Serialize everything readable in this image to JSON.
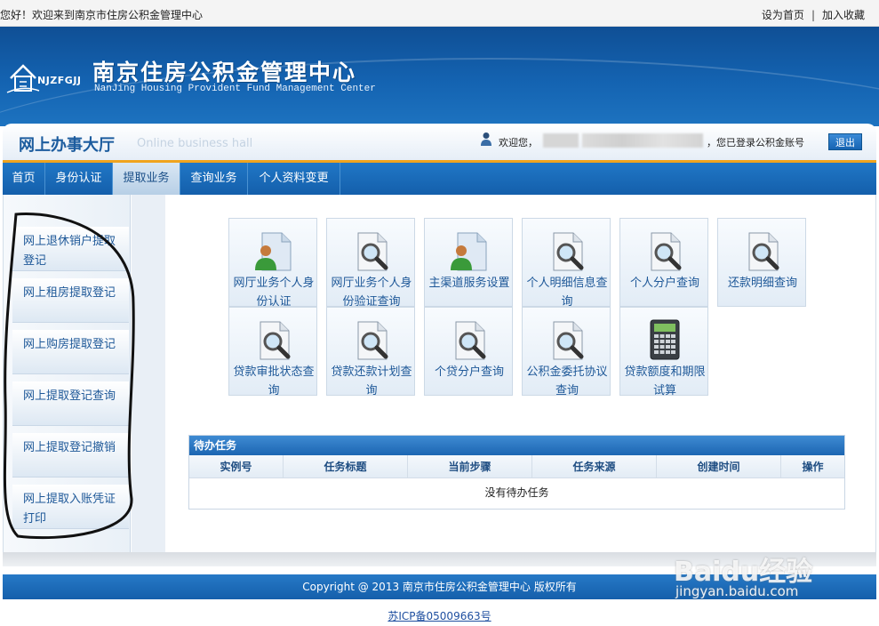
{
  "topbar": {
    "greeting": "您好！欢迎来到南京市住房公积金管理中心",
    "set_home": "设为首页",
    "separator": "|",
    "add_favorite": "加入收藏"
  },
  "banner": {
    "logo_text": "NJZFGJJ",
    "title_cn": "南京住房公积金管理中心",
    "title_en": "NanJing Housing Provident Fund Management Center"
  },
  "hall": {
    "title_cn": "网上办事大厅",
    "title_en": "Online business hall",
    "welcome": "欢迎您，",
    "logged_in": "，您已登录公积金账号",
    "logout": "退出"
  },
  "nav": {
    "tabs": [
      {
        "label": "首页"
      },
      {
        "label": "身份认证"
      },
      {
        "label": "提取业务"
      },
      {
        "label": "查询业务"
      },
      {
        "label": "个人资料变更"
      }
    ],
    "active_index": 2
  },
  "sidebar": {
    "items": [
      {
        "label": "网上退休销户提取登记"
      },
      {
        "label": "网上租房提取登记"
      },
      {
        "label": "网上购房提取登记"
      },
      {
        "label": "网上提取登记查询"
      },
      {
        "label": "网上提取登记撤销"
      },
      {
        "label": "网上提取入账凭证打印"
      }
    ]
  },
  "services": [
    {
      "label": "网厅业务个人身份认证",
      "icon": "user-doc-icon"
    },
    {
      "label": "网厅业务个人身份验证查询",
      "icon": "search-doc-icon"
    },
    {
      "label": "主渠道服务设置",
      "icon": "user-doc-icon"
    },
    {
      "label": "个人明细信息查询",
      "icon": "search-doc-icon"
    },
    {
      "label": "个人分户查询",
      "icon": "search-doc-icon"
    },
    {
      "label": "还款明细查询",
      "icon": "search-doc-icon"
    },
    {
      "label": "贷款审批状态查询",
      "icon": "search-doc-icon"
    },
    {
      "label": "贷款还款计划查询",
      "icon": "search-doc-icon"
    },
    {
      "label": "个贷分户查询",
      "icon": "search-doc-icon"
    },
    {
      "label": "公积金委托协议查询",
      "icon": "search-doc-icon"
    },
    {
      "label": "贷款额度和期限试算",
      "icon": "calculator-icon"
    }
  ],
  "tasks": {
    "title": "待办任务",
    "columns": [
      "实例号",
      "任务标题",
      "当前步骤",
      "任务来源",
      "创建时间",
      "操作"
    ],
    "empty_text": "没有待办任务"
  },
  "footer": {
    "copyright": "Copyright @ 2013 南京市住房公积金管理中心  版权所有",
    "icp": "苏ICP备05009663号"
  },
  "watermark": {
    "brand": "Baidu经验",
    "url": "jingyan.baidu.com"
  },
  "colors": {
    "brand_blue": "#1463b1",
    "accent_orange": "#f0a41e",
    "link_blue": "#1e5898"
  }
}
